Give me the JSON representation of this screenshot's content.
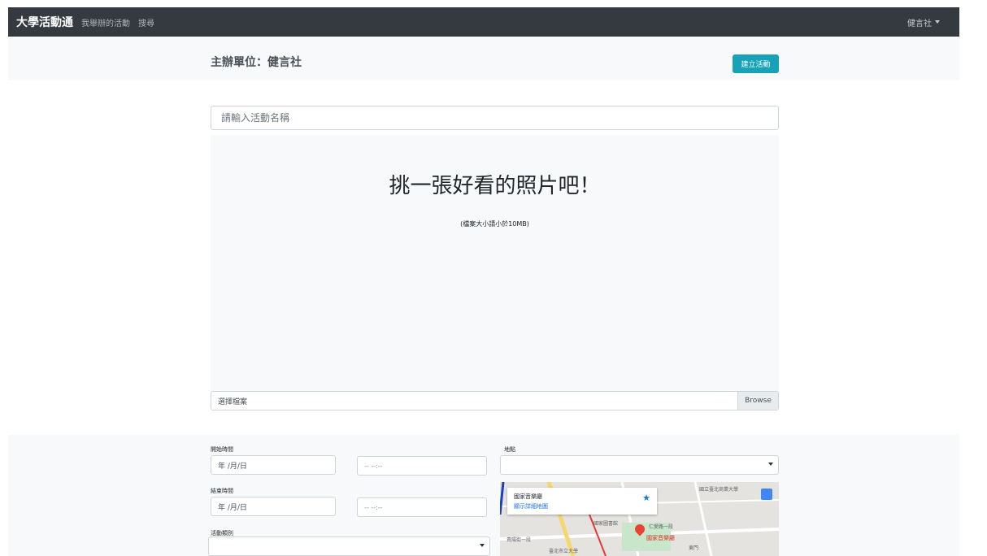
{
  "navbar": {
    "brand": "大學活動通",
    "links": [
      "我舉辦的活動",
      "搜尋"
    ],
    "user": "健言社"
  },
  "header": {
    "organizer": "主辦單位：健言社",
    "create_button": "建立活動"
  },
  "form": {
    "name_placeholder": "請輸入活動名稱",
    "photo_title": "挑一張好看的照片吧！",
    "photo_note": "(檔案大小請小於10MB)",
    "file_label": "選擇檔案",
    "browse_label": "Browse",
    "start_label": "開始時間",
    "start_date": "年 /月/日",
    "start_time": "-- --:--",
    "end_label": "結束時間",
    "end_date": "年 /月/日",
    "end_time": "-- --:--",
    "category_label": "活動類別",
    "location_label": "地點"
  },
  "map": {
    "card_title": "國家音樂廳",
    "card_link": "顯示詳細地圖",
    "place_label": "國家音樂廳",
    "labels": [
      "國立臺北商業大學",
      "國家圖書館",
      "臺北市立大學",
      "東門",
      "仁愛路一段",
      "貴陽街一段"
    ]
  },
  "colors": {
    "navbar_bg": "#343a40",
    "accent": "#17a2b8",
    "band_bg": "#f8f9fa"
  }
}
